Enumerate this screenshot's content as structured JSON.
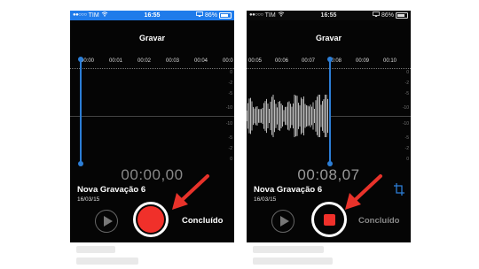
{
  "screens": [
    {
      "status": {
        "carrier": "TIM",
        "time": "16:55",
        "battery": "86%"
      },
      "title": "Gravar",
      "ticks": [
        "00:00",
        "00:01",
        "00:02",
        "00:03",
        "00:04",
        "00:0"
      ],
      "db_labels": [
        "0",
        "-2",
        "-5",
        "-10",
        "-10",
        "-5",
        "-2",
        "0"
      ],
      "timer": "00:00,00",
      "recording_name": "Nova Gravação 6",
      "recording_date": "16/03/15",
      "record_state": "idle",
      "done_label": "Concluído",
      "done_color": "#ffffff"
    },
    {
      "status": {
        "carrier": "TIM",
        "time": "16:55",
        "battery": "86%"
      },
      "title": "Gravar",
      "ticks": [
        "00:05",
        "00:06",
        "00:07",
        "00:08",
        "00:09",
        "00:10"
      ],
      "db_labels": [
        "0",
        "-2",
        "-5",
        "-10",
        "-10",
        "-5",
        "-2",
        "0"
      ],
      "timer": "00:08,07",
      "recording_name": "Nova Gravação 6",
      "recording_date": "16/03/15",
      "record_state": "recording",
      "done_label": "Concluído",
      "done_color": "#888888"
    }
  ],
  "colors": {
    "accent_blue": "#2c7ed6",
    "record_red": "#f0302a",
    "status_bar_blue": "#1f7bea",
    "annotation_arrow": "#e8322a"
  },
  "icons": [
    "play-icon",
    "record-icon",
    "stop-icon",
    "crop-icon",
    "wifi-icon",
    "airplay-icon",
    "battery-icon"
  ]
}
